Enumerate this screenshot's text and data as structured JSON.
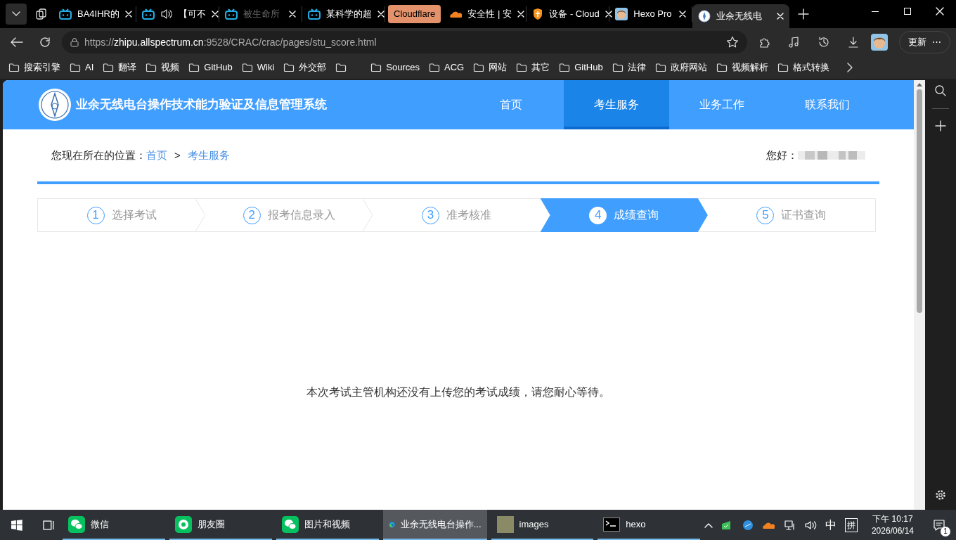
{
  "browser_tabs": [
    {
      "kind": "bili",
      "title": "BA4IHR的",
      "selected": false,
      "dimmed": false
    },
    {
      "kind": "bili-audio",
      "title": "【可不",
      "selected": false,
      "dimmed": false
    },
    {
      "kind": "bili",
      "title": "被生命所",
      "selected": false,
      "dimmed": true
    },
    {
      "kind": "bili",
      "title": "某科学的超",
      "selected": false,
      "dimmed": false
    },
    {
      "kind": "group",
      "title": "Cloudflare"
    },
    {
      "kind": "cloud",
      "title": "安全性 | 安",
      "selected": false,
      "dimmed": false
    },
    {
      "kind": "shield",
      "title": "设备 - Cloud",
      "selected": false,
      "dimmed": false
    },
    {
      "kind": "avatar",
      "title": "Hexo Pro",
      "selected": false,
      "dimmed": false
    },
    {
      "kind": "globe",
      "title": "业余无线电",
      "selected": true,
      "dimmed": false
    }
  ],
  "address_bar": {
    "scheme": "https://",
    "host": "zhipu.allspectrum.cn",
    "rest": ":9528/CRAC/crac/pages/stu_score.html"
  },
  "update_button": {
    "label": "更新",
    "more": "⋯"
  },
  "bookmarks": [
    {
      "kind": "folder",
      "label": "搜索引擎"
    },
    {
      "kind": "folder",
      "label": "AI"
    },
    {
      "kind": "folder",
      "label": "翻译"
    },
    {
      "kind": "folder",
      "label": "视频"
    },
    {
      "kind": "folder",
      "label": "GitHub"
    },
    {
      "kind": "folder",
      "label": "Wiki"
    },
    {
      "kind": "folder",
      "label": "外交部"
    },
    {
      "kind": "blank"
    },
    {
      "kind": "folder",
      "label": "Sources"
    },
    {
      "kind": "folder",
      "label": "ACG"
    },
    {
      "kind": "folder",
      "label": "网站"
    },
    {
      "kind": "folder",
      "label": "其它"
    },
    {
      "kind": "folder",
      "label": "GitHub"
    },
    {
      "kind": "folder",
      "label": "法律"
    },
    {
      "kind": "folder",
      "label": "政府网站"
    },
    {
      "kind": "folder",
      "label": "视频解析"
    },
    {
      "kind": "folder",
      "label": "格式转换"
    }
  ],
  "site": {
    "title": "业余无线电台操作技术能力验证及信息管理系统",
    "nav": [
      {
        "label": "首页",
        "selected": false
      },
      {
        "label": "考生服务",
        "selected": true
      },
      {
        "label": "业务工作",
        "selected": false
      },
      {
        "label": "联系我们",
        "selected": false
      }
    ],
    "breadcrumb": {
      "prefix": "您现在所在的位置：",
      "items": [
        "首页",
        "考生服务"
      ],
      "separator": ">"
    },
    "greeting": "您好：",
    "steps": [
      {
        "number": "1",
        "label": "选择考试",
        "selected": false
      },
      {
        "number": "2",
        "label": "报考信息录入",
        "selected": false
      },
      {
        "number": "3",
        "label": "准考核准",
        "selected": false
      },
      {
        "number": "4",
        "label": "成绩查询",
        "selected": true
      },
      {
        "number": "5",
        "label": "证书查询",
        "selected": false
      }
    ],
    "message": "本次考试主管机构还没有上传您的考试成绩，请您耐心等待。"
  },
  "taskbar": {
    "apps": [
      {
        "kind": "wechat",
        "label": "微信",
        "selected": false
      },
      {
        "kind": "moments",
        "label": "朋友圈",
        "selected": false
      },
      {
        "kind": "wechat",
        "label": "图片和视频",
        "selected": false
      },
      {
        "kind": "edge",
        "label": "业余无线电台操作...",
        "selected": true
      },
      {
        "kind": "folder",
        "label": "images",
        "selected": false
      },
      {
        "kind": "terminal",
        "label": "hexo",
        "selected": false
      }
    ],
    "ime": "中",
    "ime_mode": "拼",
    "time": "下午 10:17",
    "date": "2026/06/14",
    "notifications": "1"
  }
}
